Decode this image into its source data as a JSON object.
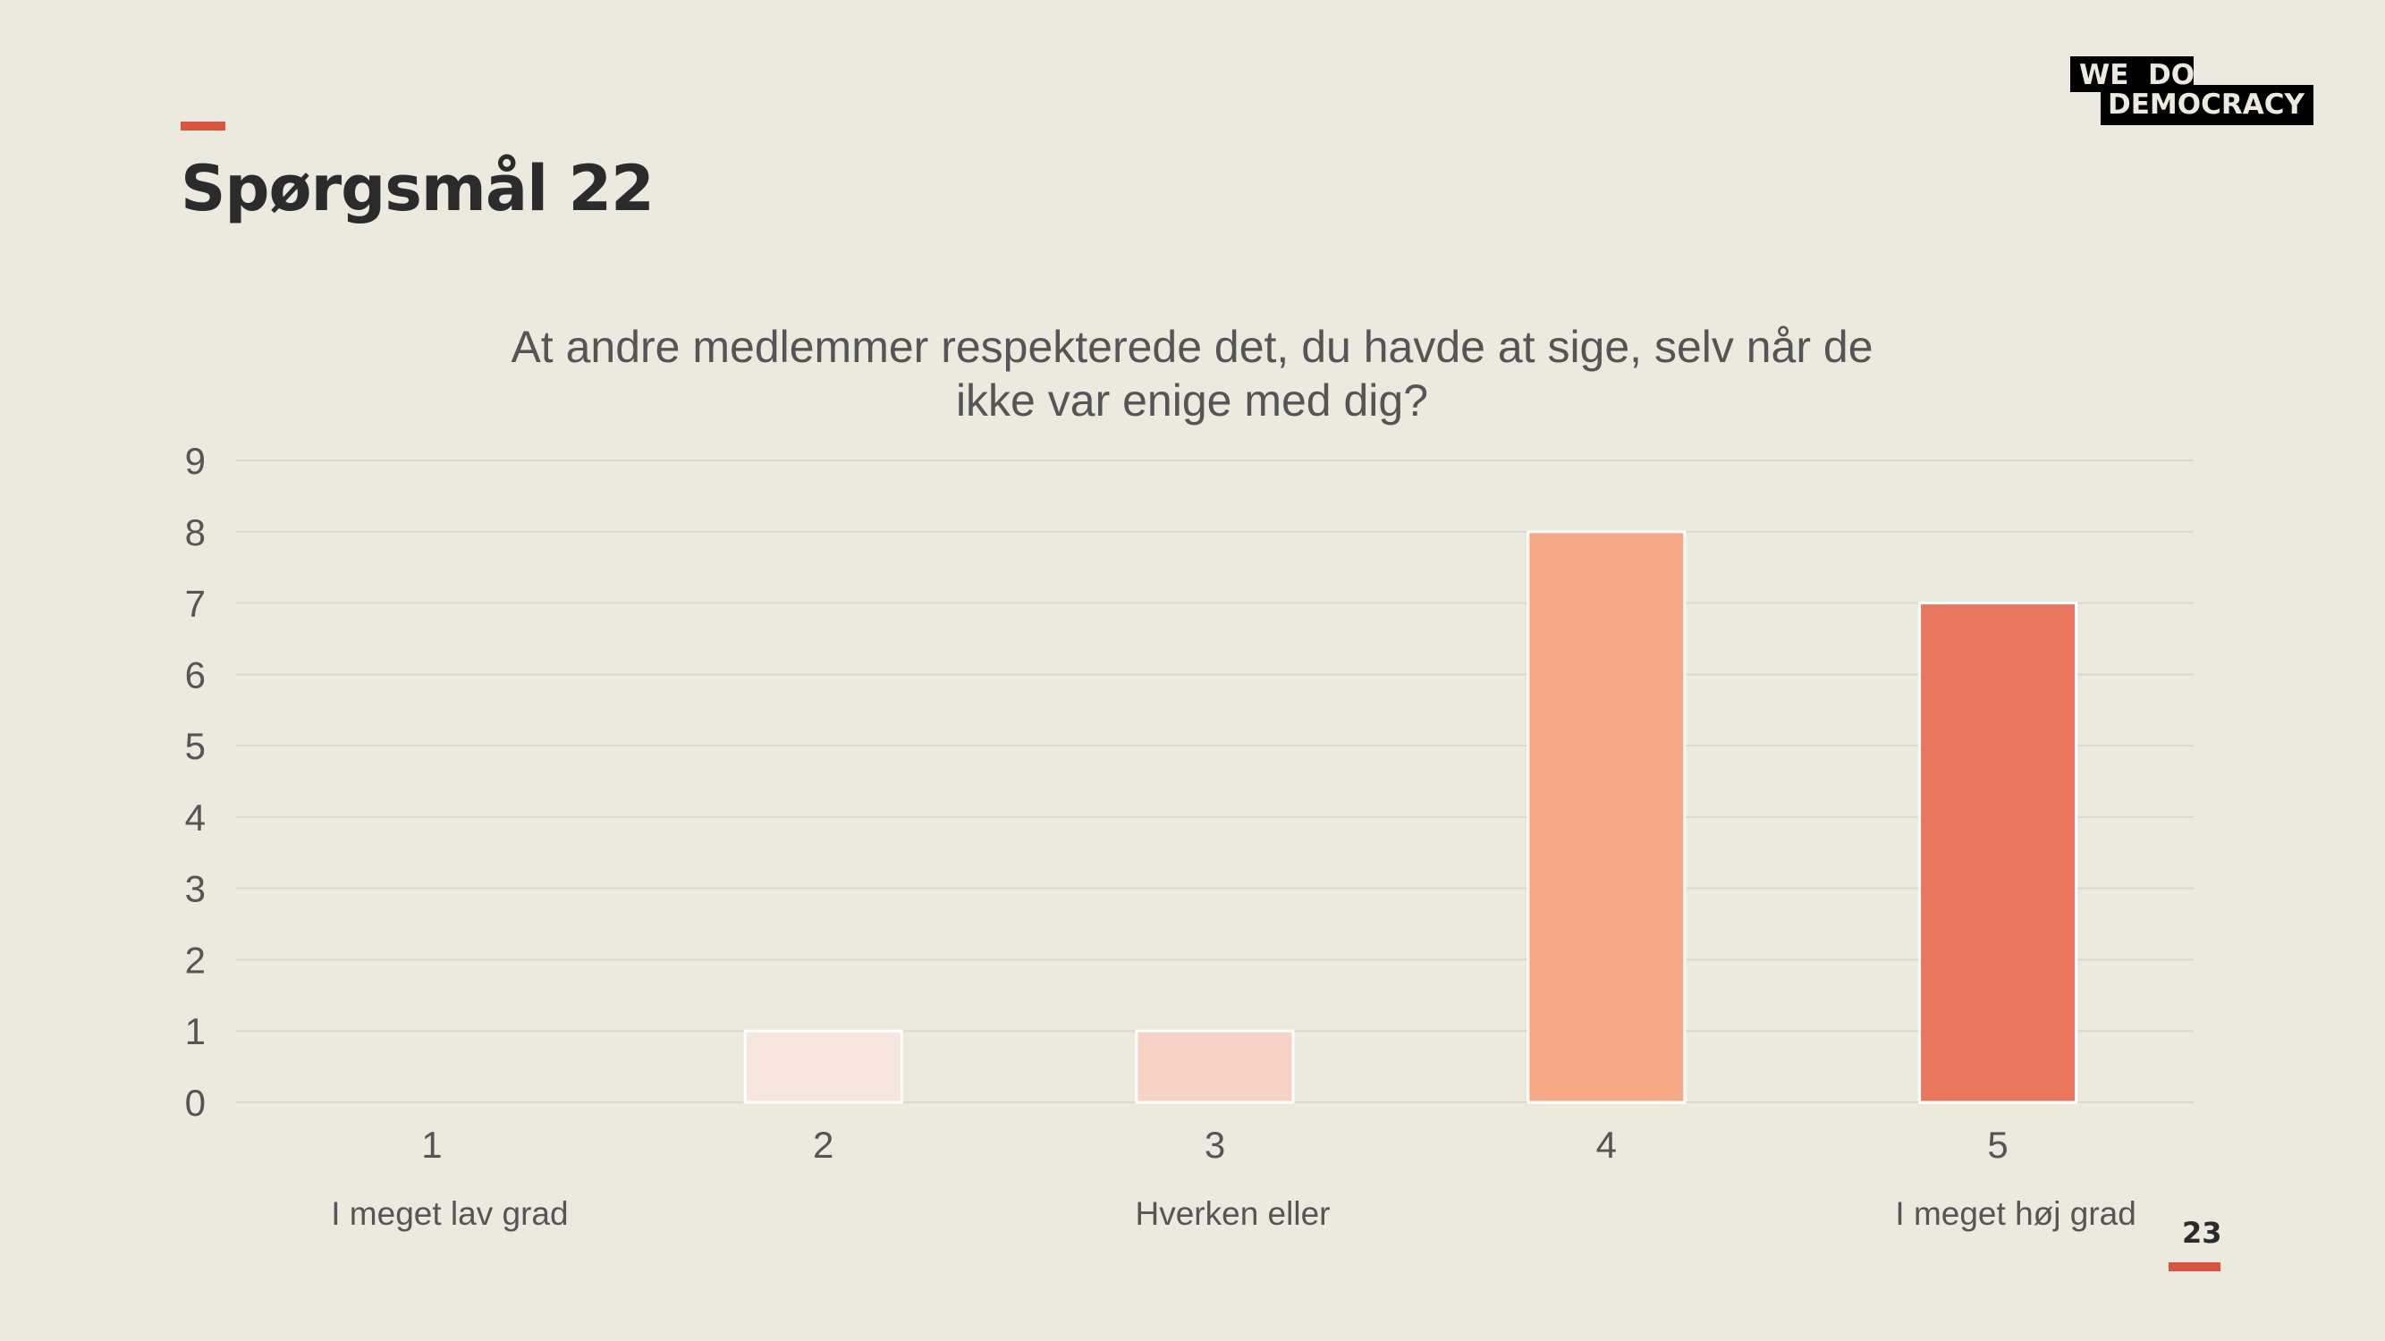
{
  "header": {
    "title": "Spørgsmål 22"
  },
  "logo": {
    "line1": "WE  DO",
    "line2": "DEMOCRACY"
  },
  "page_number": "23",
  "chart_data": {
    "type": "bar",
    "title": "At andre medlemmer respekterede det, du havde at sige, selv når de ikke var enige med dig?",
    "title_lines": [
      "At andre medlemmer respekterede det, du havde at sige, selv når de",
      "ikke var enige med dig?"
    ],
    "categories": [
      "1",
      "2",
      "3",
      "4",
      "5"
    ],
    "category_sublabels": [
      "I meget lav grad",
      "",
      "Hverken eller",
      "",
      "I meget høj grad"
    ],
    "values": [
      0,
      1,
      1,
      8,
      7
    ],
    "colors": [
      "#F6E6DF",
      "#F6E6DF",
      "#F6D3C4",
      "#F6A986",
      "#E8775D"
    ],
    "yticks": [
      "0",
      "1",
      "2",
      "3",
      "4",
      "5",
      "6",
      "7",
      "8",
      "9"
    ],
    "ylim": [
      0,
      9
    ],
    "grid": true,
    "xlabel": "",
    "ylabel": ""
  }
}
